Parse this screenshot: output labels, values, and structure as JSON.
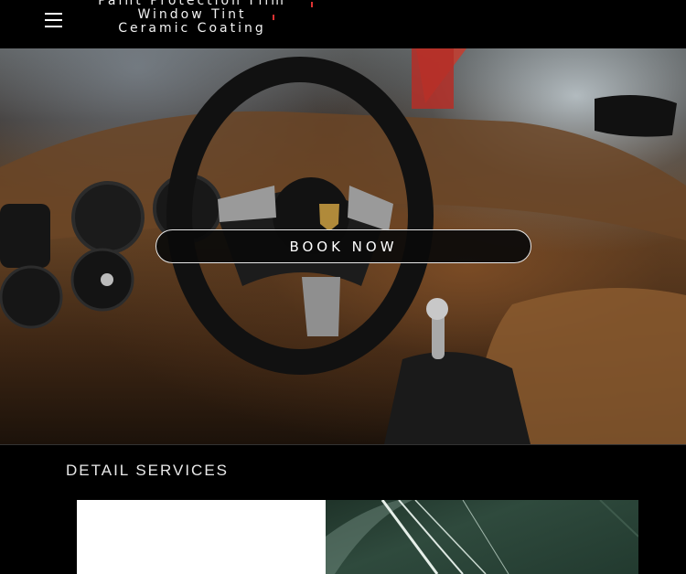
{
  "header": {
    "menu_icon": "hamburger-icon",
    "services": [
      "Paint Protection Film",
      "Window Tint",
      "Ceramic Coating"
    ]
  },
  "hero": {
    "cta_label": "BOOK NOW"
  },
  "section": {
    "title": "DETAIL SERVICES"
  },
  "colors": {
    "background": "#000000",
    "accent_tick": "#dd3333",
    "button_border": "#e8e8e8"
  }
}
